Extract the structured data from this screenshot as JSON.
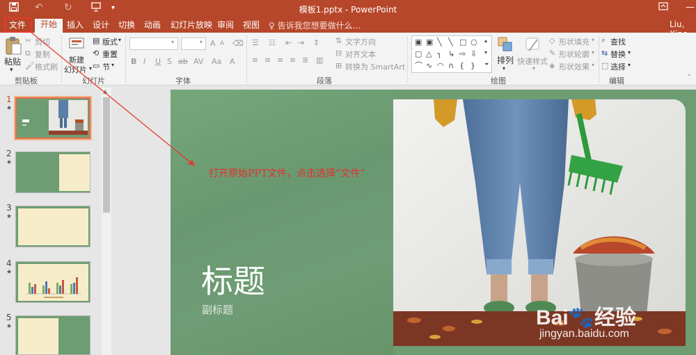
{
  "app": {
    "title": "模板1.pptx - PowerPoint",
    "user": "Liu, Xiao",
    "quick_access": [
      "save-icon",
      "undo-icon",
      "redo-icon",
      "present-icon"
    ]
  },
  "tabs": [
    {
      "label": "文件"
    },
    {
      "label": "开始"
    },
    {
      "label": "插入"
    },
    {
      "label": "设计"
    },
    {
      "label": "切换"
    },
    {
      "label": "动画"
    },
    {
      "label": "幻灯片放映"
    },
    {
      "label": "审阅"
    },
    {
      "label": "视图"
    }
  ],
  "tell_me": "♀ 告诉我您想要做什么...",
  "ribbon": {
    "clipboard": {
      "paste": "粘贴",
      "cut": "剪切",
      "copy": "复制",
      "format_painter": "格式刷",
      "label": "剪贴板"
    },
    "slides": {
      "new_slide": "新建",
      "new_slide_2": "幻灯片",
      "layout": "版式",
      "reset": "重置",
      "section": "节",
      "label": "幻灯片"
    },
    "font": {
      "label": "字体",
      "buttons": [
        "B",
        "I",
        "U",
        "S",
        "ab",
        "AV",
        "Aa",
        "A"
      ]
    },
    "paragraph": {
      "text_direction": "文字方向",
      "align_text": "对齐文本",
      "convert_smartart": "转换为 SmartArt",
      "label": "段落"
    },
    "drawing": {
      "arrange": "排列",
      "quick_styles": "快速样式",
      "shape_fill": "形状填充",
      "shape_outline": "形状轮廓",
      "shape_effects": "形状效果",
      "label": "绘图"
    },
    "editing": {
      "find": "查找",
      "replace": "替换",
      "select": "选择",
      "label": "编辑"
    }
  },
  "thumbnails": [
    {
      "num": "1"
    },
    {
      "num": "2"
    },
    {
      "num": "3"
    },
    {
      "num": "4"
    },
    {
      "num": "5"
    }
  ],
  "slide": {
    "title": "标题",
    "subtitle": "副标题"
  },
  "annotation": "打开原始PPT文件，点击选择“文件”",
  "watermark": {
    "line1": "Bai🐾经验",
    "line2": "jingyan.baidu.com"
  },
  "colors": {
    "accent": "#b7472a",
    "slide_green": "#6e9d73",
    "annotation_red": "#e3302f"
  }
}
